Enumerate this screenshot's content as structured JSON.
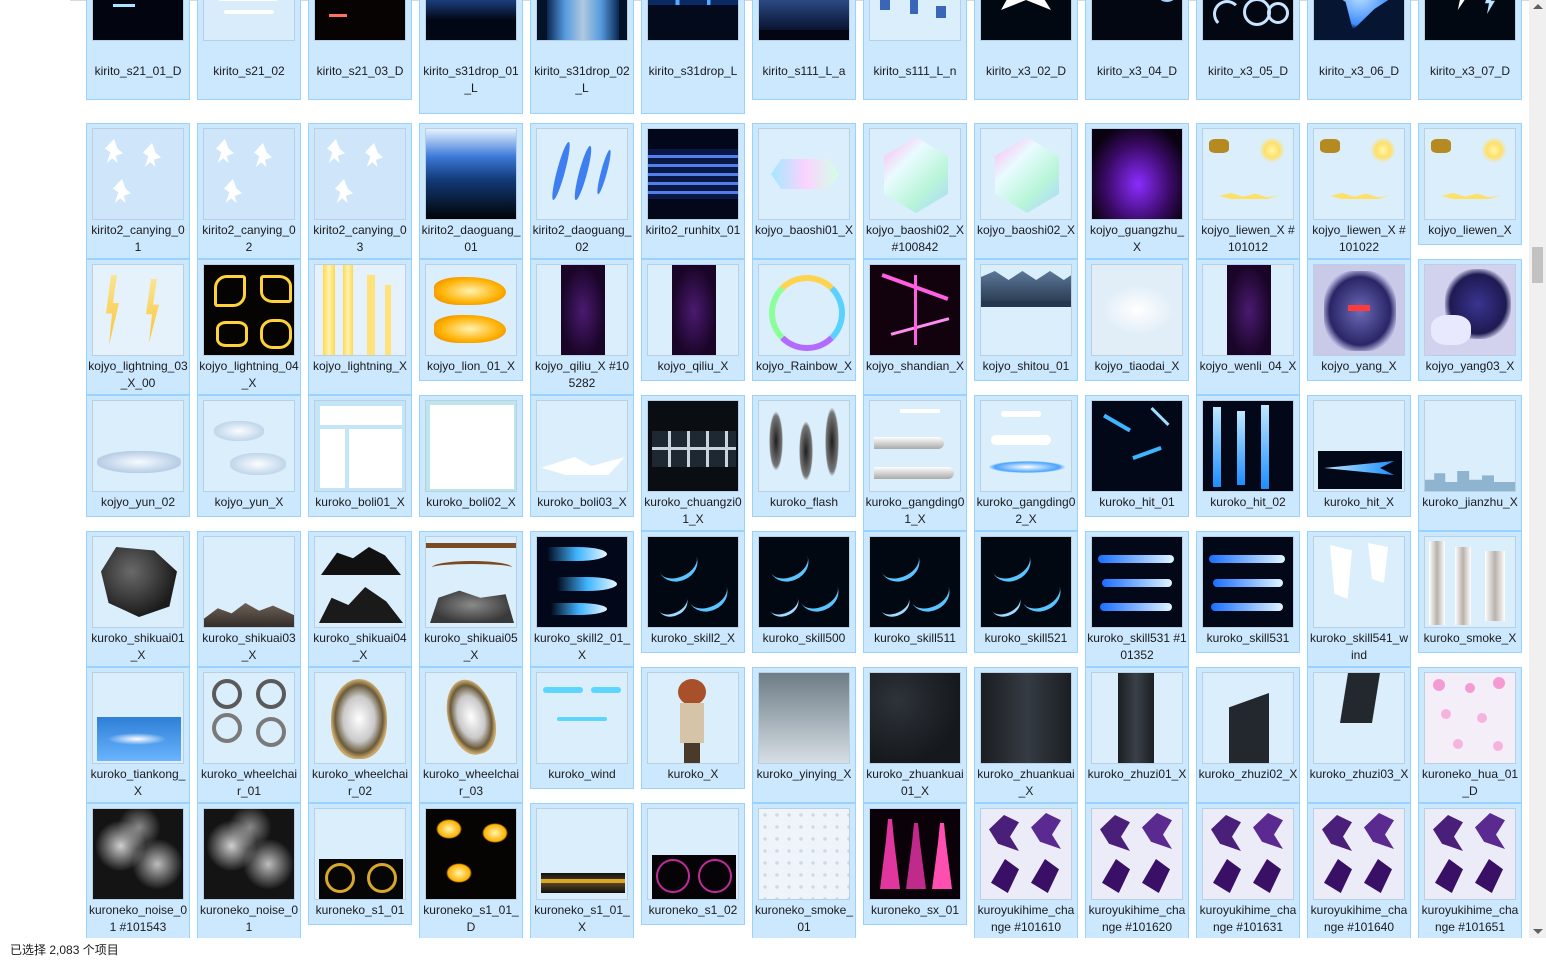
{
  "status_bar": {
    "text": "已选择 2,083 个项目"
  },
  "files": [
    {
      "name": "kirito_s21_01_D",
      "thumb": "blue-streaks-dark"
    },
    {
      "name": "kirito_s21_02",
      "thumb": "white-streaks-light"
    },
    {
      "name": "kirito_s21_03_D",
      "thumb": "red-sparks-dark"
    },
    {
      "name": "kirito_s31drop_01_L",
      "thumb": "blue-spikes-dark"
    },
    {
      "name": "kirito_s31drop_02_L",
      "thumb": "blue-curtain"
    },
    {
      "name": "kirito_s31drop_L",
      "thumb": "blue-columns"
    },
    {
      "name": "kirito_s111_L_a",
      "thumb": "blue-skyline-dark"
    },
    {
      "name": "kirito_s111_L_n",
      "thumb": "blue-shards-light"
    },
    {
      "name": "kirito_x3_02_D",
      "thumb": "white-splash-dark"
    },
    {
      "name": "kirito_x3_04_D",
      "thumb": "blue-rings-dark"
    },
    {
      "name": "kirito_x3_05_D",
      "thumb": "blue-crescents-dark"
    },
    {
      "name": "kirito_x3_06_D",
      "thumb": "blue-burst-dark"
    },
    {
      "name": "kirito_x3_07_D",
      "thumb": "white-bolts-dark"
    },
    {
      "name": "kirito2_canying_01",
      "thumb": "white-figures"
    },
    {
      "name": "kirito2_canying_02",
      "thumb": "white-figures"
    },
    {
      "name": "kirito2_canying_03",
      "thumb": "white-figures"
    },
    {
      "name": "kirito2_daoguang_01",
      "thumb": "blue-gradient"
    },
    {
      "name": "kirito2_daoguang_02",
      "thumb": "blue-slashes-light"
    },
    {
      "name": "kirito2_runhitx_01",
      "thumb": "blue-stripes-dark"
    },
    {
      "name": "kojyo_baoshi01_X",
      "thumb": "gem-flat"
    },
    {
      "name": "kojyo_baoshi02_X #100842",
      "thumb": "gem-hex"
    },
    {
      "name": "kojyo_baoshi02_X",
      "thumb": "gem-hex"
    },
    {
      "name": "kojyo_guangzhu_X",
      "thumb": "purple-glow"
    },
    {
      "name": "kojyo_liewen_X #101012",
      "thumb": "gold-crack"
    },
    {
      "name": "kojyo_liewen_X #101022",
      "thumb": "gold-crack"
    },
    {
      "name": "kojyo_liewen_X",
      "thumb": "gold-crack"
    },
    {
      "name": "kojyo_lightning_03_X_00",
      "thumb": "yellow-bolts-light"
    },
    {
      "name": "kojyo_lightning_04_X",
      "thumb": "yellow-bolts-dark"
    },
    {
      "name": "kojyo_lightning_X",
      "thumb": "yellow-pillars"
    },
    {
      "name": "kojyo_lion_01_X",
      "thumb": "gold-lion"
    },
    {
      "name": "kojyo_qiliu_X #105282",
      "thumb": "purple-mist-tall"
    },
    {
      "name": "kojyo_qiliu_X",
      "thumb": "purple-mist-tall"
    },
    {
      "name": "kojyo_Rainbow_X",
      "thumb": "rainbow-ring"
    },
    {
      "name": "kojyo_shandian_X",
      "thumb": "pink-lightning"
    },
    {
      "name": "kojyo_shitou_01",
      "thumb": "rock-strip"
    },
    {
      "name": "kojyo_tiaodai_X",
      "thumb": "white-fog"
    },
    {
      "name": "kojyo_wenli_04_X",
      "thumb": "purple-mist-tall"
    },
    {
      "name": "kojyo_yang_X",
      "thumb": "anime-beast"
    },
    {
      "name": "kojyo_yang03_X",
      "thumb": "anime-beast2"
    },
    {
      "name": "kojyo_yun_02",
      "thumb": "clouds-low"
    },
    {
      "name": "kojyo_yun_X",
      "thumb": "clouds-mid"
    },
    {
      "name": "kuroko_boli01_X",
      "thumb": "white-window"
    },
    {
      "name": "kuroko_boli02_X",
      "thumb": "white-square"
    },
    {
      "name": "kuroko_boli03_X",
      "thumb": "white-arrow"
    },
    {
      "name": "kuroko_chuangzi01_X",
      "thumb": "dark-window"
    },
    {
      "name": "kuroko_flash",
      "thumb": "dark-smudges"
    },
    {
      "name": "kuroko_gangding01_X",
      "thumb": "silver-bars"
    },
    {
      "name": "kuroko_gangding02_X",
      "thumb": "blue-ellipse"
    },
    {
      "name": "kuroko_hit_01",
      "thumb": "blue-sparks-dark"
    },
    {
      "name": "kuroko_hit_02",
      "thumb": "blue-beams-dark"
    },
    {
      "name": "kuroko_hit_X",
      "thumb": "blue-dart"
    },
    {
      "name": "kuroko_jianzhu_X",
      "thumb": "city-skyline"
    },
    {
      "name": "kuroko_shikuai01_X",
      "thumb": "boulder"
    },
    {
      "name": "kuroko_shikuai03_X",
      "thumb": "rubble-low"
    },
    {
      "name": "kuroko_shikuai04_X",
      "thumb": "rubble-dark"
    },
    {
      "name": "kuroko_shikuai05_X",
      "thumb": "rubble-rope"
    },
    {
      "name": "kuroko_skill2_01_X",
      "thumb": "blue-fireballs"
    },
    {
      "name": "kuroko_skill2_X",
      "thumb": "blue-arcs-dark"
    },
    {
      "name": "kuroko_skill500",
      "thumb": "blue-arcs-dark"
    },
    {
      "name": "kuroko_skill511",
      "thumb": "blue-arcs-dark"
    },
    {
      "name": "kuroko_skill521",
      "thumb": "blue-arcs-dark"
    },
    {
      "name": "kuroko_skill531 #101352",
      "thumb": "blue-streaks3"
    },
    {
      "name": "kuroko_skill531",
      "thumb": "blue-streaks3"
    },
    {
      "name": "kuroko_skill541_wind",
      "thumb": "white-flags"
    },
    {
      "name": "kuroko_smoke_X",
      "thumb": "smoke-strips"
    },
    {
      "name": "kuroko_tiankong_X",
      "thumb": "sky"
    },
    {
      "name": "kuroko_wheelchair_01",
      "thumb": "wheel-parts"
    },
    {
      "name": "kuroko_wheelchair_02",
      "thumb": "wheel-shield"
    },
    {
      "name": "kuroko_wheelchair_03",
      "thumb": "wheel-shield2"
    },
    {
      "name": "kuroko_wind",
      "thumb": "cyan-wind"
    },
    {
      "name": "kuroko_X",
      "thumb": "anime-girl"
    },
    {
      "name": "kuroko_yinying_X",
      "thumb": "grey-gradient"
    },
    {
      "name": "kuroko_zhuankuai01_X",
      "thumb": "dark-texture"
    },
    {
      "name": "kuroko_zhuankuai_X",
      "thumb": "dark-texture2"
    },
    {
      "name": "kuroko_zhuzi01_X",
      "thumb": "dark-pillar"
    },
    {
      "name": "kuroko_zhuzi02_X",
      "thumb": "dark-panel"
    },
    {
      "name": "kuroko_zhuzi03_X",
      "thumb": "dark-panel2"
    },
    {
      "name": "kuroneko_hua_01_D",
      "thumb": "pink-petals"
    },
    {
      "name": "kuroneko_noise_01 #101543",
      "thumb": "grey-noise"
    },
    {
      "name": "kuroneko_noise_01",
      "thumb": "grey-noise"
    },
    {
      "name": "kuroneko_s1_01",
      "thumb": "gold-circles"
    },
    {
      "name": "kuroneko_s1_01_D",
      "thumb": "gold-flames-dark"
    },
    {
      "name": "kuroneko_s1_01_X",
      "thumb": "gold-band"
    },
    {
      "name": "kuroneko_s1_02",
      "thumb": "pink-circles"
    },
    {
      "name": "kuroneko_smoke_01",
      "thumb": "white-dots"
    },
    {
      "name": "kuroneko_sx_01",
      "thumb": "pink-silhouettes"
    },
    {
      "name": "kuroyukihime_change #101610",
      "thumb": "purple-butterfly"
    },
    {
      "name": "kuroyukihime_change #101620",
      "thumb": "purple-butterfly"
    },
    {
      "name": "kuroyukihime_change #101631",
      "thumb": "purple-butterfly"
    },
    {
      "name": "kuroyukihime_change #101640",
      "thumb": "purple-butterfly"
    },
    {
      "name": "kuroyukihime_change #101651",
      "thumb": "purple-butterfly"
    }
  ]
}
